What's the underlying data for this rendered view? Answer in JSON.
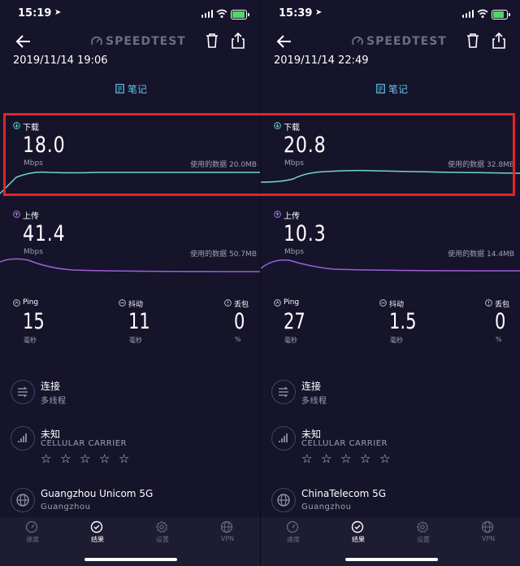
{
  "screens": [
    {
      "status": {
        "time": "15:19",
        "location_icon": "location-arrow-icon"
      },
      "brand": "SPEEDTEST",
      "datetime": "2019/11/14 19:06",
      "notes_label": "笔记",
      "download": {
        "label": "下载",
        "value": "18.0",
        "unit": "Mbps",
        "used_data": "使用的数据 20.0MB"
      },
      "upload": {
        "label": "上传",
        "value": "41.4",
        "unit": "Mbps",
        "used_data": "使用的数据 50.7MB"
      },
      "ping": {
        "label": "Ping",
        "value": "15",
        "unit": "毫秒"
      },
      "jitter": {
        "label": "抖动",
        "value": "11",
        "unit": "毫秒"
      },
      "loss": {
        "label": "丢包",
        "value": "0",
        "unit": "%"
      },
      "connection": {
        "title": "连接",
        "subtitle": "多线程"
      },
      "carrier": {
        "title": "未知",
        "subtitle": "CELLULAR CARRIER",
        "rating_stars": 0,
        "rating_max": 5
      },
      "server": {
        "title": "Guangzhou Unicom 5G",
        "subtitle": "Guangzhou"
      },
      "tabs": [
        {
          "label": "速度"
        },
        {
          "label": "结果"
        },
        {
          "label": "设置"
        },
        {
          "label": "VPN"
        }
      ],
      "active_tab": "结果"
    },
    {
      "status": {
        "time": "15:39",
        "location_icon": "location-arrow-icon"
      },
      "brand": "SPEEDTEST",
      "datetime": "2019/11/14 22:49",
      "notes_label": "笔记",
      "download": {
        "label": "下载",
        "value": "20.8",
        "unit": "Mbps",
        "used_data": "使用的数据 32.8MB"
      },
      "upload": {
        "label": "上传",
        "value": "10.3",
        "unit": "Mbps",
        "used_data": "使用的数据 14.4MB"
      },
      "ping": {
        "label": "Ping",
        "value": "27",
        "unit": "毫秒"
      },
      "jitter": {
        "label": "抖动",
        "value": "1.5",
        "unit": "毫秒"
      },
      "loss": {
        "label": "丢包",
        "value": "0",
        "unit": "%"
      },
      "connection": {
        "title": "连接",
        "subtitle": "多线程"
      },
      "carrier": {
        "title": "未知",
        "subtitle": "CELLULAR CARRIER",
        "rating_stars": 0,
        "rating_max": 5
      },
      "server": {
        "title": "ChinaTelecom 5G",
        "subtitle": "Guangzhou"
      },
      "tabs": [
        {
          "label": "速度"
        },
        {
          "label": "结果"
        },
        {
          "label": "设置"
        },
        {
          "label": "VPN"
        }
      ],
      "active_tab": "结果"
    }
  ],
  "colors": {
    "background": "#15142b",
    "download_line": "#6fd6d0",
    "upload_line": "#9b5fd6",
    "accent": "#5ec8f0",
    "highlight": "#e0262a"
  }
}
